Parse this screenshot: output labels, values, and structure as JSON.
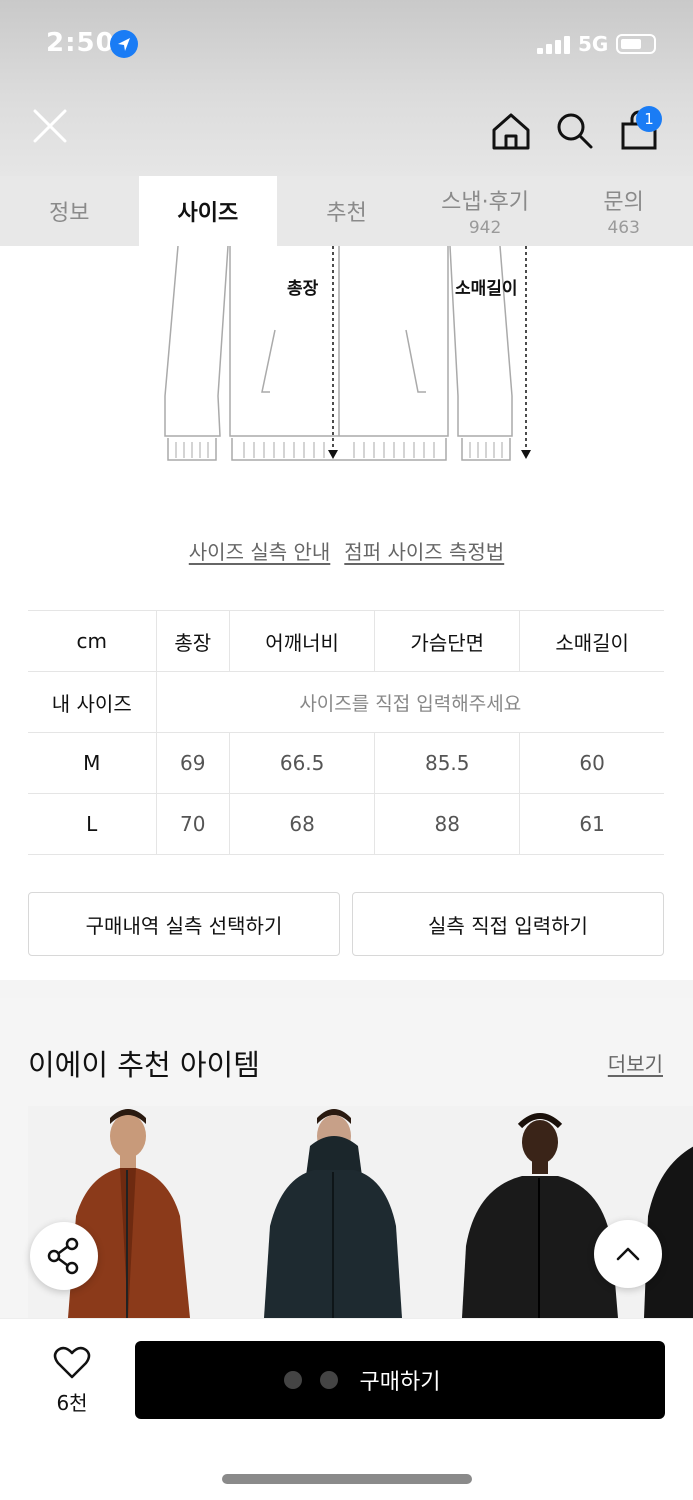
{
  "status_bar": {
    "time": "2:50",
    "network": "5G"
  },
  "header": {
    "cart_count": "1"
  },
  "tabs": [
    {
      "label": "정보",
      "count": ""
    },
    {
      "label": "사이즈",
      "count": ""
    },
    {
      "label": "추천",
      "count": ""
    },
    {
      "label": "스냅·후기",
      "count": "942"
    },
    {
      "label": "문의",
      "count": "463"
    }
  ],
  "illustration": {
    "total_length_label": "총장",
    "sleeve_length_label": "소매길이"
  },
  "guide_links": {
    "actual_size_guide": "사이즈 실측 안내",
    "measure_method": "점퍼 사이즈 측정법"
  },
  "size_table": {
    "headers": [
      "cm",
      "총장",
      "어깨너비",
      "가슴단면",
      "소매길이"
    ],
    "my_size_label": "내 사이즈",
    "my_size_placeholder": "사이즈를 직접 입력해주세요",
    "rows": [
      {
        "size": "M",
        "values": [
          "69",
          "66.5",
          "85.5",
          "60"
        ]
      },
      {
        "size": "L",
        "values": [
          "70",
          "68",
          "88",
          "61"
        ]
      }
    ]
  },
  "buttons": {
    "select_purchase": "구매내역 실측 선택하기",
    "direct_input": "실측 직접 입력하기"
  },
  "recommend": {
    "title": "이에이 추천 아이템",
    "more": "더보기"
  },
  "bottom": {
    "likes": "6천",
    "buy_label": "구매하기"
  },
  "colors": {
    "accent": "#1a7cf5",
    "buy_button": "#000000"
  }
}
